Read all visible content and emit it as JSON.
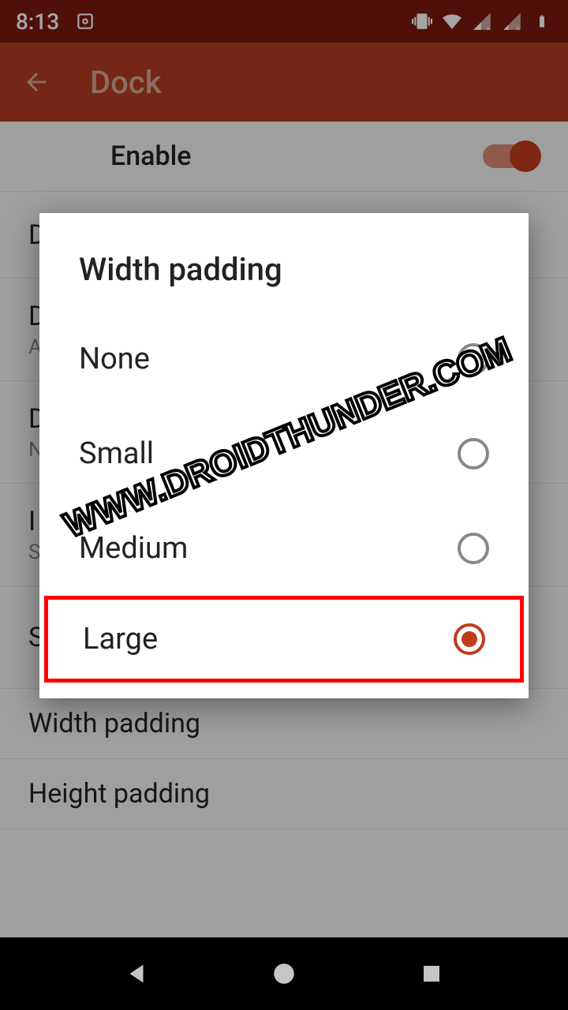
{
  "status": {
    "time": "8:13"
  },
  "appbar": {
    "title": "Dock"
  },
  "settings": {
    "enable": {
      "label": "Enable"
    },
    "items": [
      {
        "title": "D",
        "sub": ""
      },
      {
        "title": "D",
        "sub": "A"
      },
      {
        "title": "D",
        "sub": "N"
      },
      {
        "title": "I",
        "sub": "S"
      },
      {
        "title": "S",
        "sub": ""
      }
    ],
    "widthPadding": {
      "label": "Width padding"
    },
    "heightPadding": {
      "label": "Height padding"
    }
  },
  "dialog": {
    "title": "Width padding",
    "options": [
      {
        "label": "None",
        "selected": false
      },
      {
        "label": "Small",
        "selected": false
      },
      {
        "label": "Medium",
        "selected": false
      },
      {
        "label": "Large",
        "selected": true
      }
    ]
  },
  "watermark": "WWW.DROIDTHUNDER.COM",
  "colors": {
    "accent": "#c03d1c",
    "appbar": "#b33d20",
    "statusbar": "#7a1a0f"
  }
}
